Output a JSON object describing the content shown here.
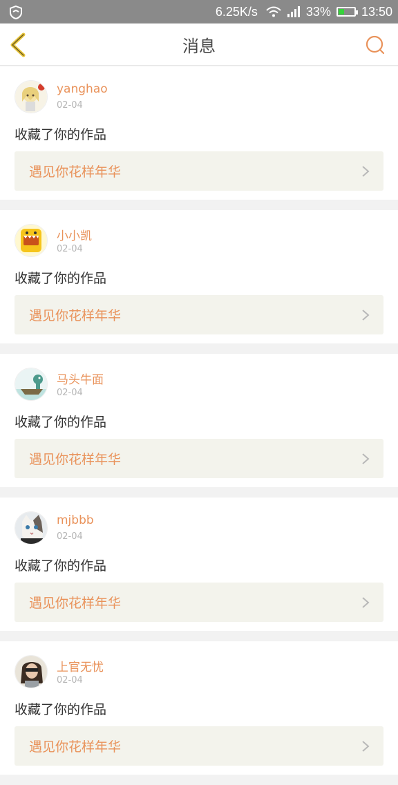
{
  "status_bar": {
    "net_speed": "6.25K/s",
    "battery_percent": "33%",
    "battery_level": 0.33,
    "time": "13:50",
    "icons": [
      "shield-icon",
      "wifi-icon",
      "signal-icon",
      "battery-icon"
    ]
  },
  "header": {
    "title": "消息",
    "back_icon": "chevron-left-icon",
    "search_icon": "search-icon"
  },
  "colors": {
    "accent": "#e9925a",
    "back_icon": "#e8c53c",
    "status_bar_bg": "#8a8a8a",
    "card_link_bg": "#f3f3ec"
  },
  "messages": [
    {
      "username": "yanghao",
      "date": "02-04",
      "action": "收藏了你的作品",
      "work_title": "遇见你花样年华",
      "avatar": "anime-girl-avatar"
    },
    {
      "username": "小小凯",
      "date": "02-04",
      "action": "收藏了你的作品",
      "work_title": "遇见你花样年华",
      "avatar": "yellow-monster-avatar"
    },
    {
      "username": "马头牛面",
      "date": "02-04",
      "action": "收藏了你的作品",
      "work_title": "遇见你花样年华",
      "avatar": "boat-scene-avatar"
    },
    {
      "username": "mjbbb",
      "date": "02-04",
      "action": "收藏了你的作品",
      "work_title": "遇见你花样年华",
      "avatar": "cat-avatar"
    },
    {
      "username": "上官无忧",
      "date": "02-04",
      "action": "收藏了你的作品",
      "work_title": "遇见你花样年华",
      "avatar": "person-avatar"
    }
  ]
}
